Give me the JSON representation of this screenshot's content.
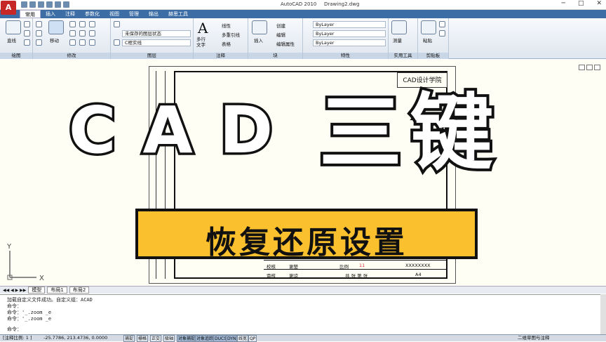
{
  "window": {
    "app_title": "AutoCAD 2010",
    "doc_title": "Drawing2.dwg"
  },
  "tabs": [
    "常用",
    "插入",
    "注释",
    "参数化",
    "视图",
    "管理",
    "输出",
    "赫思工具"
  ],
  "ribbon": {
    "draw": {
      "title": "绘图",
      "line": "直线"
    },
    "modify": {
      "title": "修改",
      "move": "移动"
    },
    "layer": {
      "title": "图层",
      "state": "未保存的图层状态",
      "current": "C框实线"
    },
    "annot": {
      "title": "注释",
      "mtext": "多行\n文字",
      "linear": "线性",
      "mleader": "多重引线",
      "table": "表格"
    },
    "block": {
      "title": "块",
      "insert": "插入",
      "create": "创建",
      "edit": "编辑",
      "attr": "编辑属性"
    },
    "props": {
      "title": "特性",
      "color": "ByLayer",
      "ltype": "ByLayer",
      "lweight": "ByLayer"
    },
    "util": {
      "title": "实用工具",
      "measure": "测量"
    },
    "clip": {
      "title": "剪贴板",
      "paste": "粘贴"
    }
  },
  "drawing": {
    "stamp": "CAD设计学院",
    "tb_r1": [
      "校核",
      "谢楚",
      "比例",
      "11",
      "XXXXXXXX"
    ],
    "tb_r2": [
      "审核",
      "谢谅",
      "共  张  第  张",
      "A4"
    ],
    "headline": "CAD",
    "headline2": "三键",
    "banner": "恢复还原设置"
  },
  "ucs": {
    "y": "Y",
    "x": "X"
  },
  "layout_tabs": [
    "模型",
    "布局1",
    "布局2"
  ],
  "command": {
    "lines": [
      "加载自定义文件成功。自定义组：ACAD",
      "命令：",
      "命令：'_.zoom _e",
      "命令：'_.zoom _e",
      "",
      "命令："
    ]
  },
  "status": {
    "scale": "[注释比例: 1 ]",
    "coords": "-25.7786, 213.4736, 0.0000",
    "toggles": [
      "捕捉",
      "栅格",
      "正交",
      "极轴",
      "对象捕捉",
      "对象追踪",
      "DUCS",
      "DYN",
      "线宽",
      "QP"
    ],
    "workspace": "二维草图与注释"
  }
}
